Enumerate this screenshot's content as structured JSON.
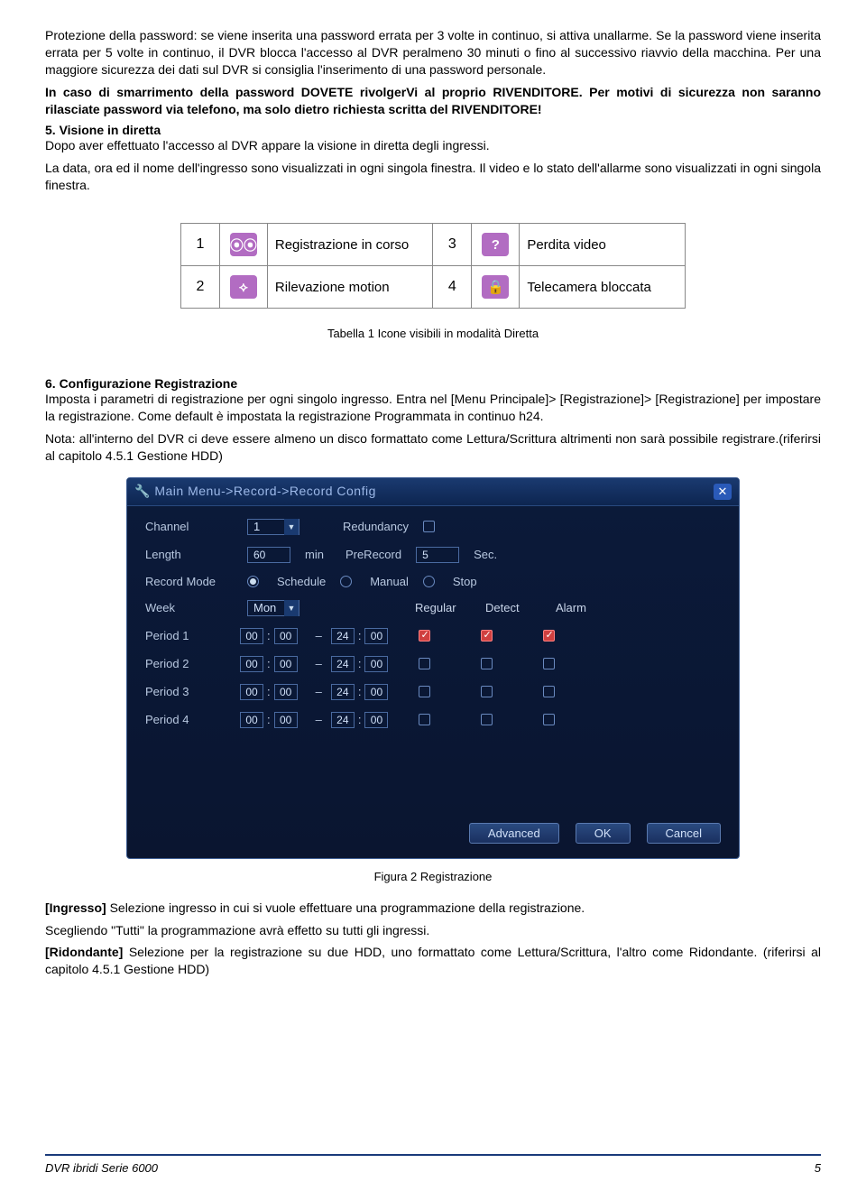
{
  "intro": {
    "p1": "Protezione della password: se viene inserita una password errata per 3 volte in continuo, si attiva unallarme. Se la password viene inserita errata per 5 volte in continuo, il DVR blocca l'accesso al DVR peralmeno 30 minuti o fino al successivo riavvio della macchina. Per una maggiore sicurezza dei dati sul DVR si consiglia l'inserimento di una password personale.",
    "p2": "In caso di smarrimento della password DOVETE rivolgerVi al proprio RIVENDITORE. Per motivi di sicurezza non saranno rilasciate password via telefono, ma solo dietro richiesta scritta del RIVENDITORE!"
  },
  "section5": {
    "title": "5. Visione in diretta",
    "p1": "Dopo aver effettuato l'accesso al DVR appare la visione in diretta degli ingressi.",
    "p2": "La data, ora ed il nome dell'ingresso sono visualizzati in ogni singola finestra. Il video e lo stato dell'allarme sono visualizzati in ogni singola finestra."
  },
  "iconTable": {
    "rows": [
      {
        "n": "1",
        "icon": "rec",
        "desc": "Registrazione in corso"
      },
      {
        "n": "3",
        "icon": "?",
        "desc": "Perdita video"
      },
      {
        "n": "2",
        "icon": "motion",
        "desc": "Rilevazione motion"
      },
      {
        "n": "4",
        "icon": "lock",
        "desc": "Telecamera bloccata"
      }
    ],
    "caption": "Tabella 1 Icone visibili in modalità Diretta"
  },
  "section6": {
    "title": "6. Configurazione Registrazione",
    "p1": "Imposta i parametri di registrazione per ogni singolo ingresso. Entra nel [Menu Principale]> [Registrazione]> [Registrazione] per impostare la registrazione. Come default è impostata la registrazione Programmata in continuo h24.",
    "p2": "Nota: all'interno del DVR ci deve essere almeno un disco formattato come Lettura/Scrittura altrimenti non sarà possibile registrare.(riferirsi al capitolo 4.5.1 Gestione HDD)"
  },
  "dvr": {
    "title": "Main Menu->Record->Record Config",
    "labels": {
      "channel": "Channel",
      "redundancy": "Redundancy",
      "length": "Length",
      "min": "min",
      "prerecord": "PreRecord",
      "sec": "Sec.",
      "recordMode": "Record Mode",
      "schedule": "Schedule",
      "manual": "Manual",
      "stop": "Stop",
      "week": "Week",
      "regular": "Regular",
      "detect": "Detect",
      "alarm": "Alarm",
      "period1": "Period 1",
      "period2": "Period 2",
      "period3": "Period 3",
      "period4": "Period 4"
    },
    "values": {
      "channel": "1",
      "length": "60",
      "prerecord": "5",
      "week": "Mon",
      "t_start": {
        "h": "00",
        "m": "00"
      },
      "t_end": {
        "h": "24",
        "m": "00"
      }
    },
    "buttons": {
      "advanced": "Advanced",
      "ok": "OK",
      "cancel": "Cancel"
    }
  },
  "figCaption": "Figura 2 Registrazione",
  "closing": {
    "p1a": "[Ingresso]",
    "p1b": " Selezione ingresso in cui si vuole effettuare una programmazione della registrazione.",
    "p2": "Scegliendo \"Tutti\" la programmazione avrà effetto su tutti gli ingressi.",
    "p3a": "[Ridondante]",
    "p3b": " Selezione per la registrazione su due HDD, uno formattato come Lettura/Scrittura, l'altro come Ridondante. (riferirsi al capitolo 4.5.1 Gestione HDD)"
  },
  "footer": {
    "left": "DVR ibridi Serie 6000",
    "right": "5"
  }
}
